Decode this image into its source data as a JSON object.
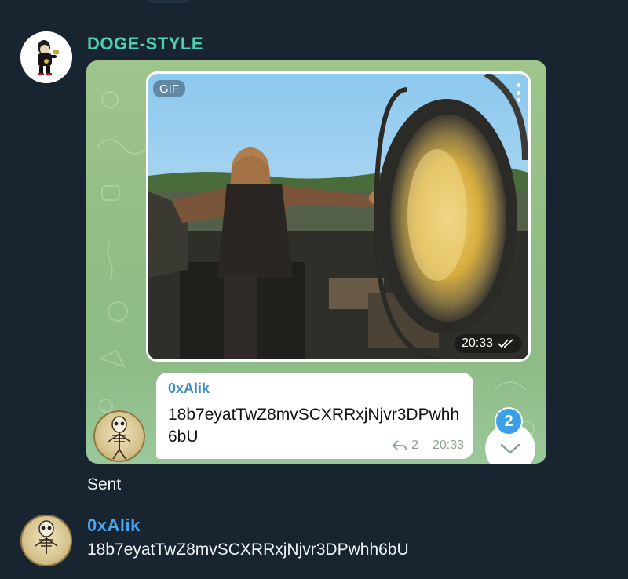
{
  "messages": {
    "first": {
      "sender": "DOGE-STYLE",
      "gif": {
        "badge": "GIF",
        "time": "20:33"
      },
      "reply": {
        "sender": "0xAlik",
        "text": "18b7eyatTwZ8mvSCXRRxjNjvr3DPwhh6bU",
        "reply_count": "2",
        "time": "20:33"
      },
      "caption": "Sent"
    },
    "second": {
      "sender": "0xAlik",
      "text": "18b7eyatTwZ8mvSCXRRxjNjvr3DPwhh6bU"
    }
  },
  "overlay": {
    "unread_count": "2"
  },
  "colors": {
    "background": "#182530",
    "doge_name": "#4fcfb5",
    "alik_name": "#4aa3f0",
    "bubble": "#9fc58c",
    "badge": "#3aa0e8"
  }
}
